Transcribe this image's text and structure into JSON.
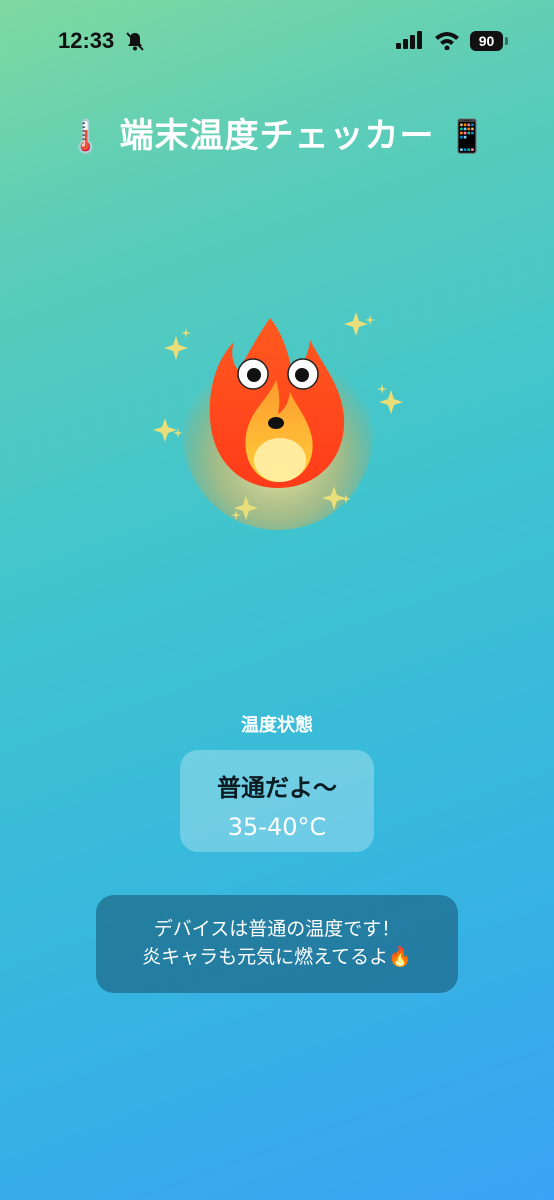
{
  "status_bar": {
    "time": "12:33",
    "battery": "90"
  },
  "header": {
    "title_icon_left": "🌡️",
    "title": "端末温度チェッカー",
    "title_icon_right": "📱"
  },
  "mascot": {
    "icon": "fire-mascot-icon"
  },
  "status": {
    "label": "温度状態",
    "state": "普通だよ〜",
    "range": "35-40°C"
  },
  "message": {
    "line1": "デバイスは普通の温度です！",
    "line2": "炎キャラも元気に燃えてるよ",
    "line2_icon": "🔥"
  },
  "colors": {
    "gradient_top": "#7fd9a0",
    "gradient_bottom": "#3aa3f5",
    "message_bg": "#16506e"
  }
}
